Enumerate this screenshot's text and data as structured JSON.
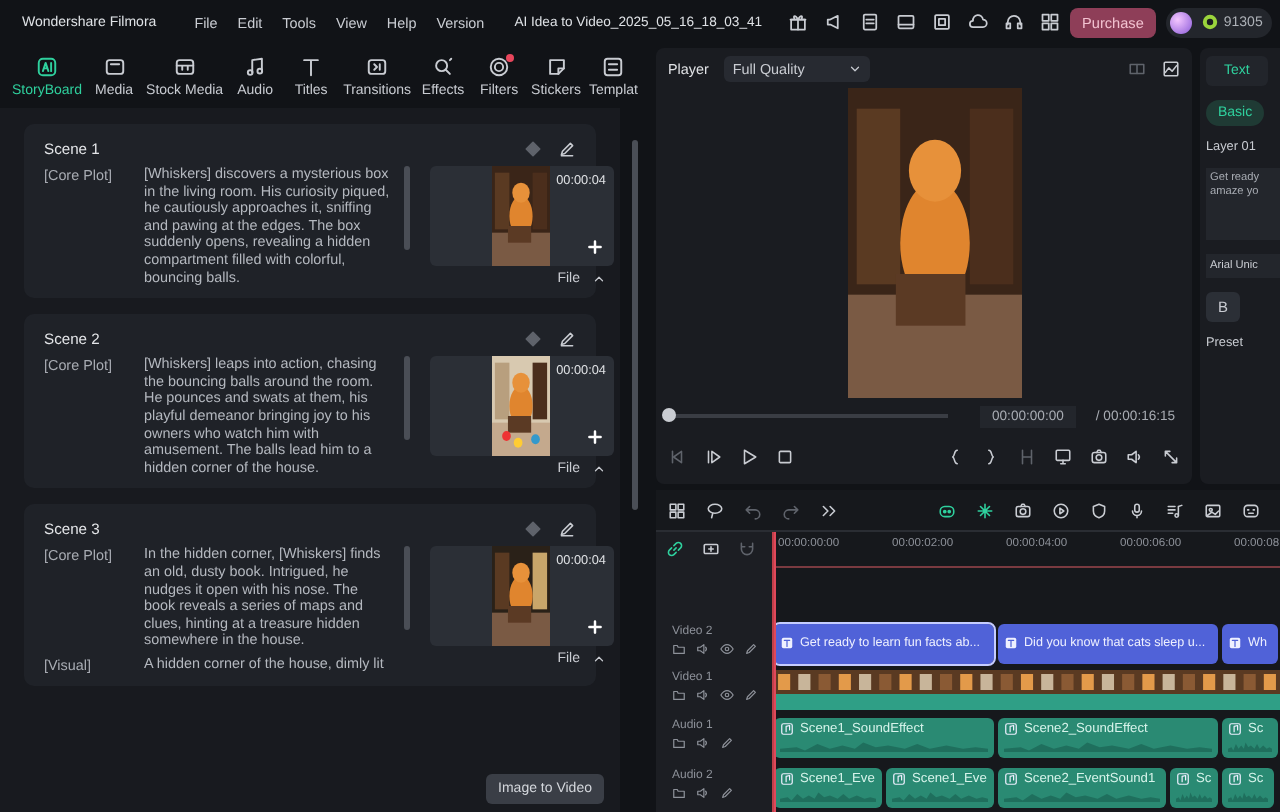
{
  "app": {
    "name": "Wondershare Filmora"
  },
  "menu": [
    "File",
    "Edit",
    "Tools",
    "View",
    "Help",
    "Version"
  ],
  "project_title": "AI Idea to Video_2025_05_16_18_03_41",
  "purchase": "Purchase",
  "credits": "91305",
  "tabs": [
    {
      "label": "StoryBoard",
      "selected": true,
      "dot": false
    },
    {
      "label": "Media",
      "selected": false,
      "dot": false
    },
    {
      "label": "Stock Media",
      "selected": false,
      "dot": false
    },
    {
      "label": "Audio",
      "selected": false,
      "dot": false
    },
    {
      "label": "Titles",
      "selected": false,
      "dot": false
    },
    {
      "label": "Transitions",
      "selected": false,
      "dot": false
    },
    {
      "label": "Effects",
      "selected": false,
      "dot": false
    },
    {
      "label": "Filters",
      "selected": false,
      "dot": true
    },
    {
      "label": "Stickers",
      "selected": false,
      "dot": false
    },
    {
      "label": "Templat",
      "selected": false,
      "dot": false
    }
  ],
  "scenes": [
    {
      "title": "Scene 1",
      "rows": [
        {
          "label": "[Core Plot]",
          "text": "[Whiskers] discovers a mysterious box in the living room. His curiosity piqued, he cautiously approaches it, sniffing and pawing at the edges. The box suddenly opens, revealing a hidden compartment filled with colorful, bouncing balls."
        }
      ],
      "duration": "00:00:04",
      "file": "File"
    },
    {
      "title": "Scene 2",
      "rows": [
        {
          "label": "[Core Plot]",
          "text": "[Whiskers] leaps into action, chasing the bouncing balls around the room. He pounces and swats at them, his playful demeanor bringing joy to his owners who watch him with amusement. The balls lead him to a hidden corner of the house."
        }
      ],
      "duration": "00:00:04",
      "file": "File"
    },
    {
      "title": "Scene 3",
      "rows": [
        {
          "label": "[Core Plot]",
          "text": "In the hidden corner, [Whiskers] finds an old, dusty book. Intrigued, he nudges it open with his nose. The book reveals a series of maps and clues, hinting at a treasure hidden somewhere in the house."
        },
        {
          "label": "[Visual]",
          "text": "A hidden corner of the house, dimly lit"
        }
      ],
      "duration": "00:00:04",
      "file": "File"
    }
  ],
  "image_to_video": "Image to Video",
  "player": {
    "label": "Player",
    "quality": "Full Quality",
    "current": "00:00:00:00",
    "total": "/ 00:00:16:15",
    "level": 0
  },
  "inspector": {
    "tab": "Text",
    "subtab": "Basic",
    "layer": "Layer 01",
    "text_value": "Get ready\namaze yo",
    "font": "Arial Unic",
    "bold": "B",
    "preset": "Preset"
  },
  "timeline": {
    "ruler": [
      "00:00:00:00",
      "00:00:02:00",
      "00:00:04:00",
      "00:00:06:00",
      "00:00:08"
    ],
    "tracks": [
      {
        "name": "Video 2",
        "kind": "title",
        "clips": [
          "Get ready to learn fun facts ab...",
          "Did you know that cats sleep u...",
          "Wh"
        ]
      },
      {
        "name": "Video 1",
        "kind": "video"
      },
      {
        "name": "Audio 1",
        "kind": "audio",
        "clips": [
          "Scene1_SoundEffect",
          "Scene2_SoundEffect",
          "Sc"
        ]
      },
      {
        "name": "Audio 2",
        "kind": "audio",
        "clips": [
          "Scene1_Eve",
          "Scene1_Eve",
          "Scene2_EventSound1",
          "Sc",
          "Sc"
        ]
      }
    ]
  }
}
